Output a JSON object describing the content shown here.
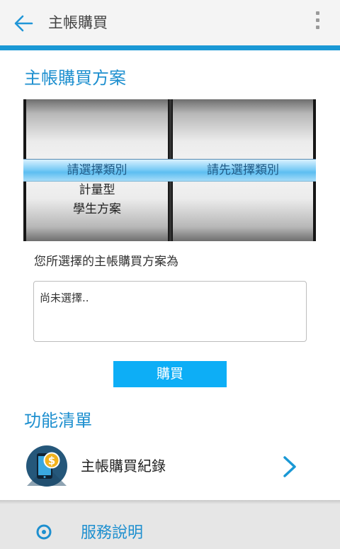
{
  "appbar": {
    "title": "主帳購買",
    "back_icon": "arrow-left-icon",
    "menu_icon": "more-vertical-icon"
  },
  "purchase": {
    "section_title": "主帳購買方案",
    "picker": {
      "left_wheel": {
        "selected": "請選擇類別",
        "items_below": [
          "計量型",
          "學生方案"
        ]
      },
      "right_wheel": {
        "selected": "請先選擇類別"
      }
    },
    "result_prompt": "您所選擇的主帳購買方案為",
    "result_value": "尚未選擇..",
    "buy_label": "購買"
  },
  "features": {
    "section_title": "功能清單",
    "items": [
      {
        "label": "主帳購買紀錄",
        "icon": "phone-dollar-icon"
      }
    ]
  },
  "service": {
    "label": "服務說明",
    "icon": "location-pin-icon"
  },
  "colors": {
    "accent": "#1a98d5",
    "button": "#0daef6",
    "section_title": "#1d8fcf"
  }
}
